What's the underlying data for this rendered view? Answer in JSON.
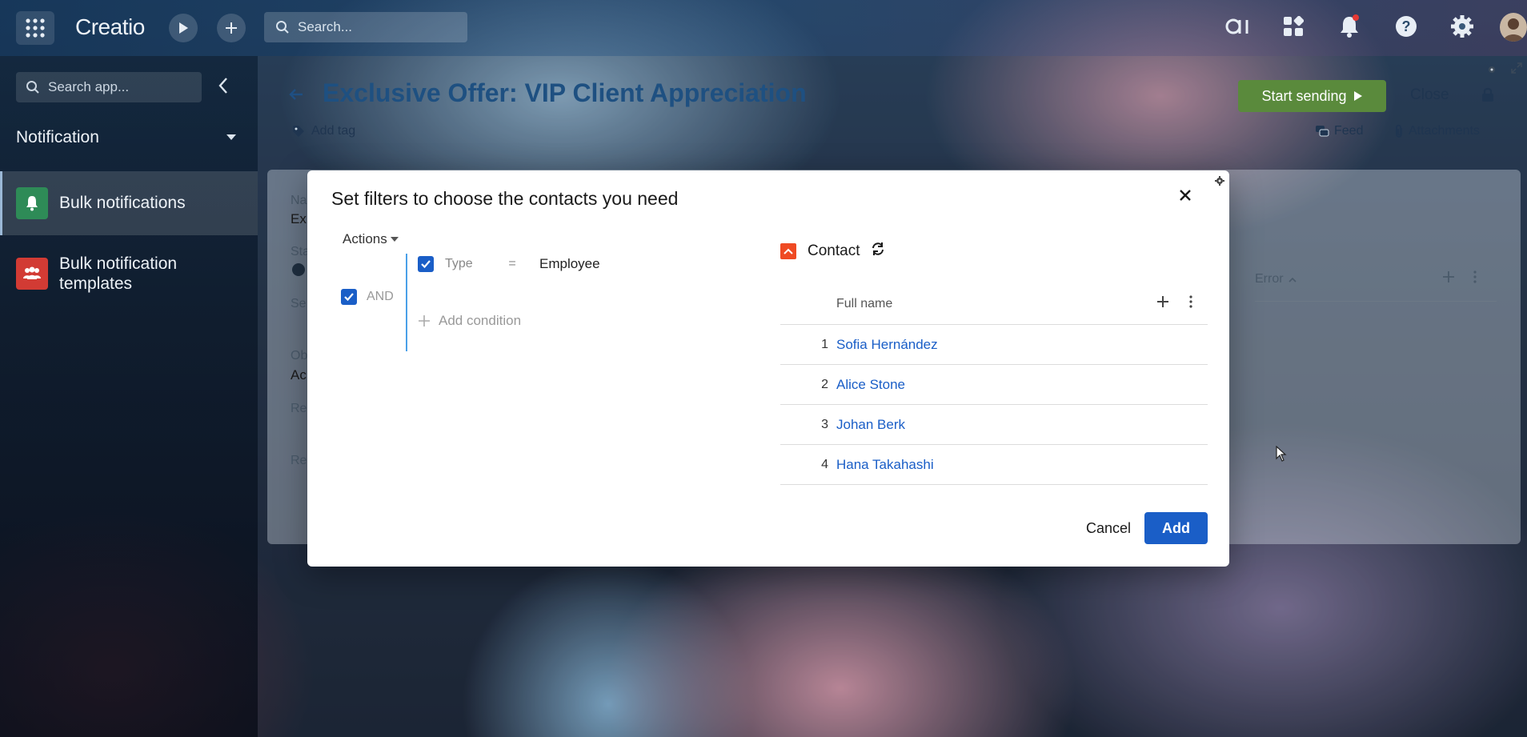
{
  "app": {
    "logo": "Creatio"
  },
  "topbar": {
    "search_placeholder": "Search...",
    "icons": [
      "apps-grid-icon",
      "play-icon",
      "plus-icon",
      "search-icon",
      "ai-icon",
      "widgets-icon",
      "bell-icon",
      "help-icon",
      "gear-icon",
      "avatar"
    ],
    "notification_dot_color": "#e53935"
  },
  "sidebar": {
    "search_placeholder": "Search app...",
    "section": "Notification",
    "items": [
      {
        "label": "Bulk notifications",
        "active": true,
        "badge_color": "#2e8b57"
      },
      {
        "label": "Bulk notification templates",
        "active": false,
        "badge_color": "#d23b34"
      }
    ]
  },
  "page": {
    "title": "Exclusive Offer: VIP Client Appreciation",
    "add_tag": "Add tag",
    "start_sending": "Start sending",
    "close": "Close",
    "feed": "Feed",
    "attachments": "Attachments",
    "bg_fields": [
      "Na",
      "Ex",
      "Sta",
      "Se",
      "Ob",
      "Ac",
      "Re",
      "Re"
    ],
    "error_column": "Error"
  },
  "modal": {
    "title": "Set filters to choose the contacts you need",
    "actions": "Actions",
    "group_operator": "AND",
    "condition": {
      "column": "Type",
      "operator": "=",
      "value": "Employee"
    },
    "add_condition": "Add condition",
    "object": "Contact",
    "grid": {
      "column": "Full name",
      "rows": [
        {
          "num": "1",
          "name": "Sofia Hernández"
        },
        {
          "num": "2",
          "name": "Alice Stone"
        },
        {
          "num": "3",
          "name": "Johan Berk"
        },
        {
          "num": "4",
          "name": "Hana Takahashi"
        }
      ]
    },
    "cancel": "Cancel",
    "add": "Add"
  }
}
